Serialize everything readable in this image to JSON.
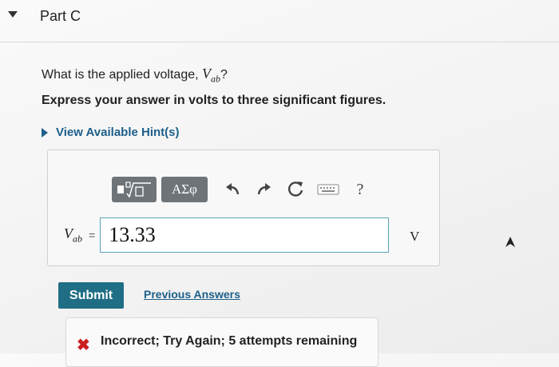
{
  "part": {
    "title": "Part C"
  },
  "question": {
    "prefix": "What is the applied voltage, ",
    "variable": "V",
    "variable_sub": "ab",
    "suffix": "?",
    "instruction": "Express your answer in volts to three significant figures.",
    "hint_link": "View Available Hint(s)"
  },
  "toolbar": {
    "greek_label": "ΑΣφ",
    "buttons": [
      "templates-icon",
      "greek-symbols",
      "undo-icon",
      "redo-icon",
      "reset-icon",
      "keyboard-icon",
      "help-icon"
    ],
    "help_label": "?"
  },
  "answer": {
    "variable": "V",
    "variable_sub": "ab",
    "equals": "=",
    "value": "13.33",
    "unit": "V"
  },
  "actions": {
    "submit_label": "Submit",
    "previous_answers_label": "Previous Answers"
  },
  "feedback": {
    "mark": "✖",
    "text": "Incorrect; Try Again; 5 attempts remaining"
  },
  "colors": {
    "accent": "#1f6e85",
    "link": "#1d5f8a",
    "error": "#cc1f1f",
    "toolbar_button": "#6f7478"
  }
}
